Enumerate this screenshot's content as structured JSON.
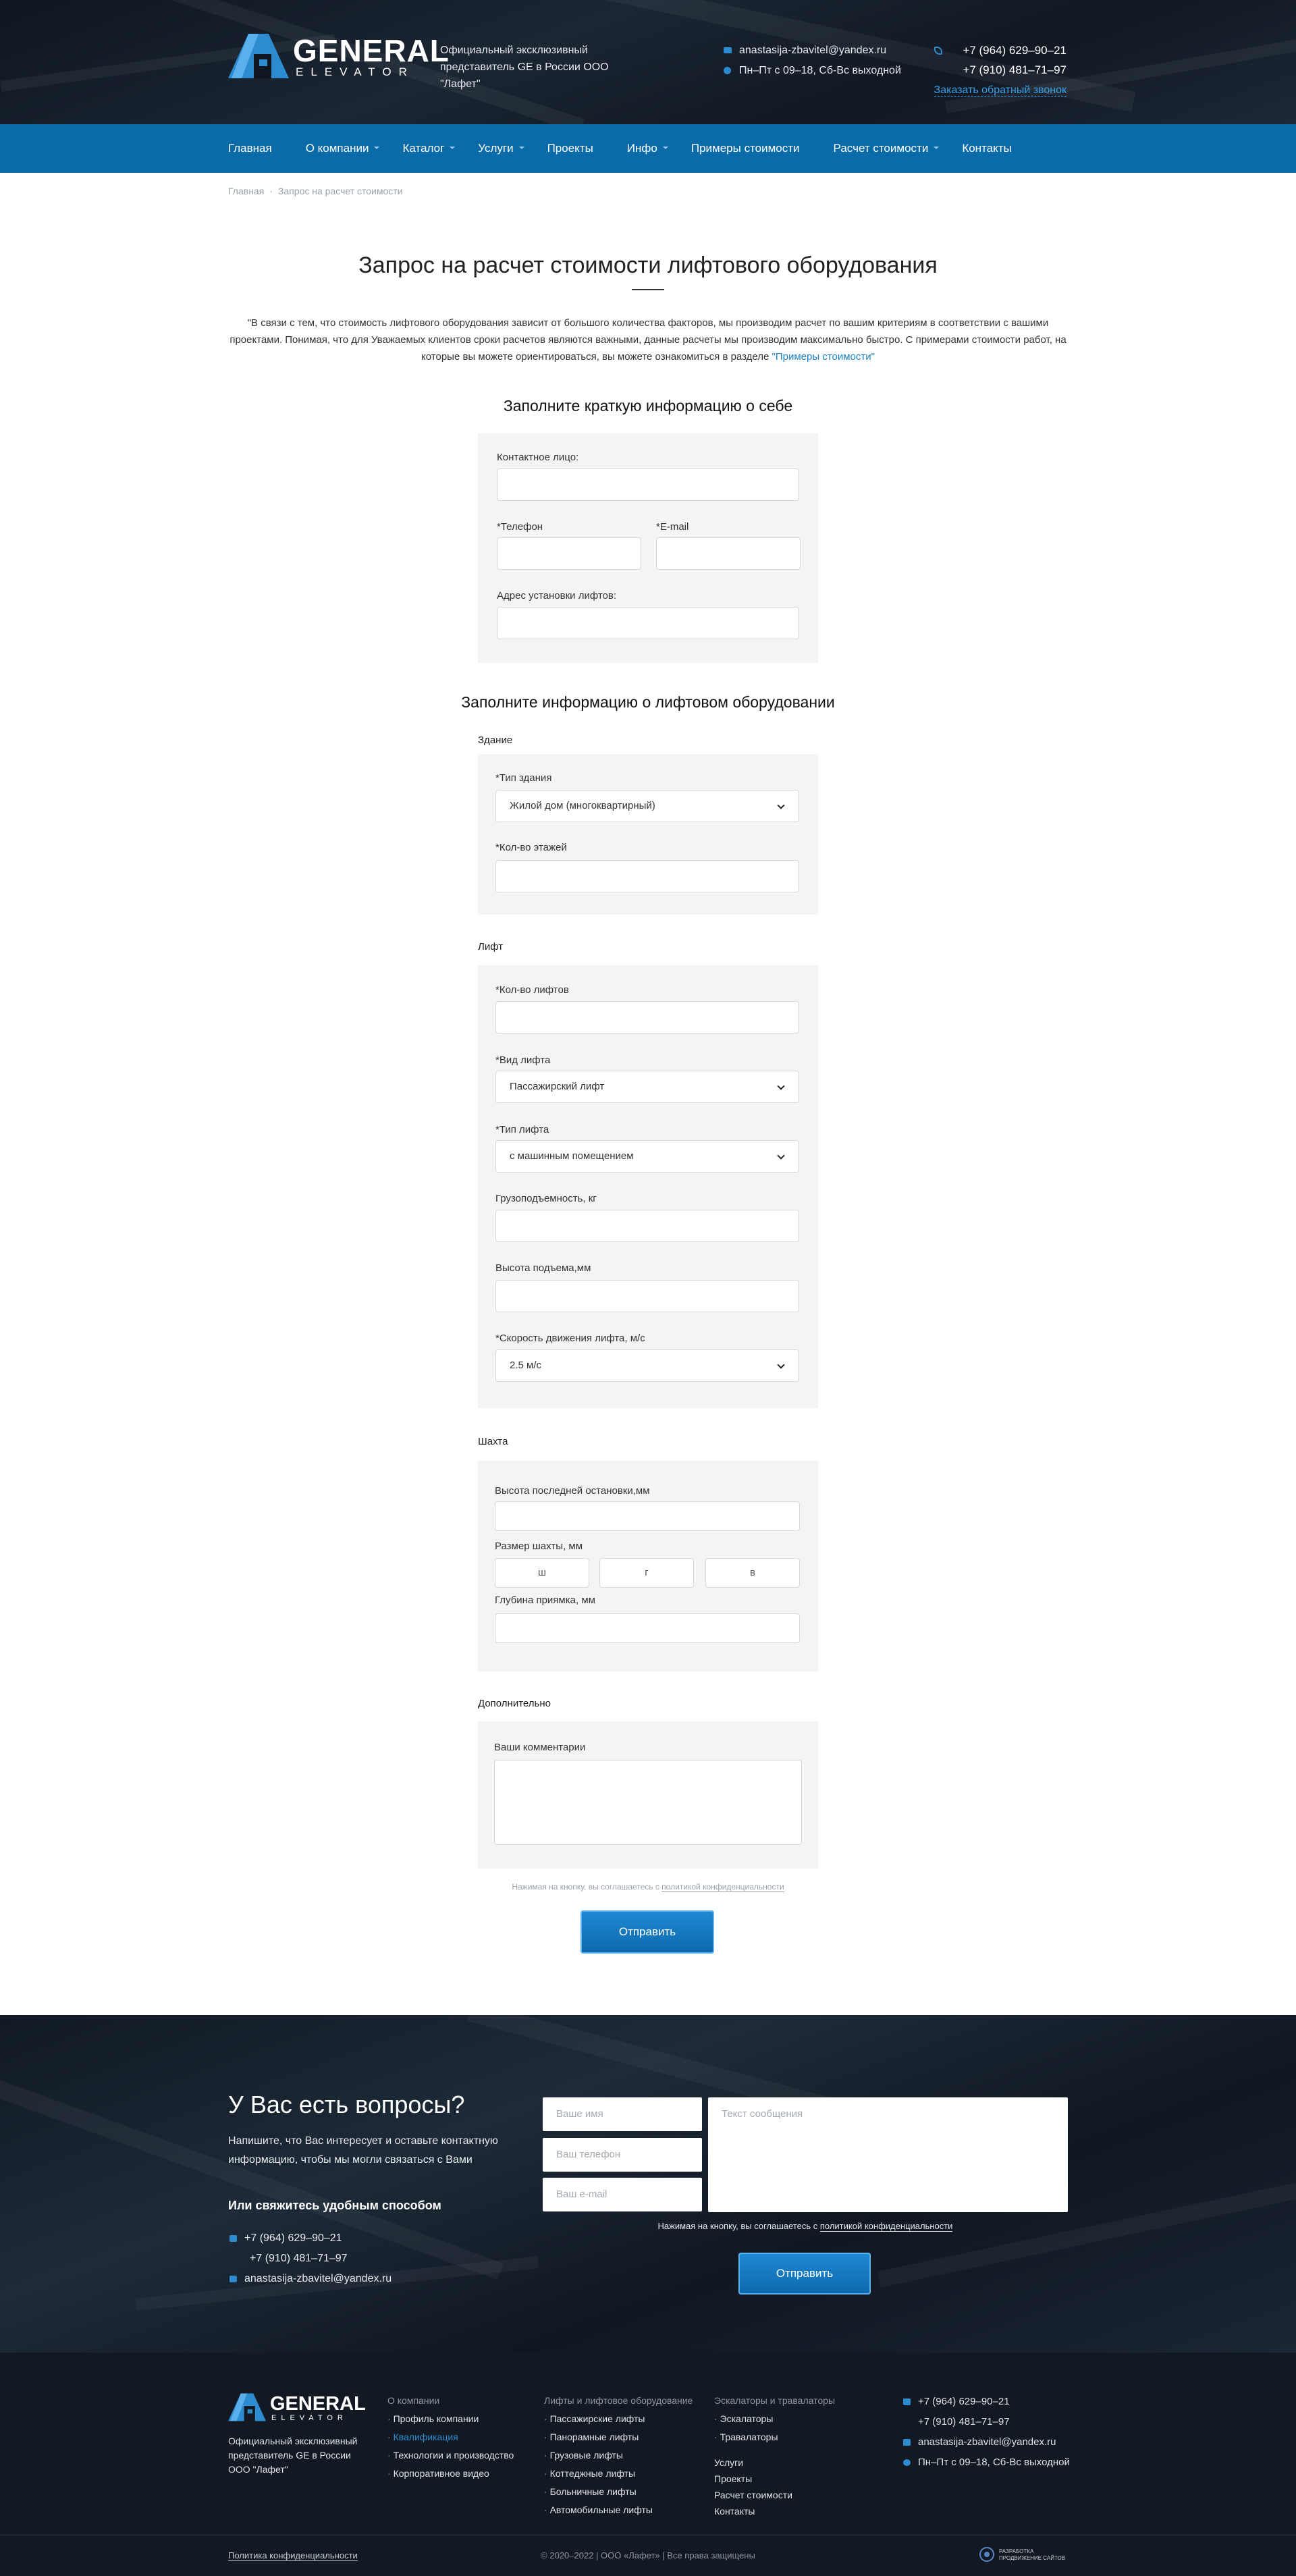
{
  "header": {
    "logo_title": "GENERAL",
    "logo_sub": "ELEVATOR",
    "desc_line1": "Официальный эксклюзивный",
    "desc_line2": "представитель GE в России ООО \"Лафет\"",
    "email": "anastasija-zbavitel@yandex.ru",
    "hours": "Пн–Пт с 09–18, Сб-Вс выходной",
    "phone1": "+7 (964) 629–90–21",
    "phone2": "+7 (910) 481–71–97",
    "callback": "Заказать обратный звонок"
  },
  "nav": {
    "items": [
      "Главная",
      "О компании",
      "Каталог",
      "Услуги",
      "Проекты",
      "Инфо",
      "Примеры стоимости",
      "Расчет стоимости",
      "Контакты"
    ]
  },
  "breadcrumb": {
    "home": "Главная",
    "current": "Запрос на расчет стоимости"
  },
  "page": {
    "title": "Запрос на расчет стоимости лифтового оборудования",
    "intro_1": "\"В связи с тем, что стоимость лифтового оборудования зависит от большого количества факторов, мы производим расчет по вашим критериям в соответствии с вашими проектами. Понимая, что для Уважаемых клиентов сроки расчетов являются важными, данные расчеты мы производим максимально быстро. С примерами стоимости работ, на которые вы можете ориентироваться, вы можете ознакомиться в разделе ",
    "intro_link": "\"Примеры стоимости\""
  },
  "contact": {
    "heading": "Заполните краткую информацию о себе",
    "person_label": "Контактное лицо:",
    "phone_label": "*Телефон",
    "email_label": "*E-mail",
    "address_label": "Адрес установки лифтов:"
  },
  "equipment": {
    "heading": "Заполните информацию о лифтовом оборудовании",
    "building": {
      "title": "Здание",
      "type_label": "*Тип здания",
      "type_value": "Жилой дом (многоквартирный)",
      "floors_label": "*Кол-во этажей"
    },
    "lift": {
      "title": "Лифт",
      "count_label": "*Кол-во лифтов",
      "kind_label": "*Вид лифта",
      "kind_value": "Пассажирский лифт",
      "type_label": "*Тип лифта",
      "type_value": "с машинным помещением",
      "capacity_label": "Грузоподъемность, кг",
      "height_label": "Высота  подъема,мм",
      "speed_label": "*Скорость движения лифта, м/с",
      "speed_value": "2.5 м/с"
    },
    "shaft": {
      "title": "Шахта",
      "last_stop_label": "Высота последней остановки,мм",
      "size_label": "Размер шахты, мм",
      "w_ph": "ш",
      "d_ph": "г",
      "h_ph": "в",
      "pit_label": "Глубина приямка, мм"
    },
    "extra": {
      "title": "Дополнительно",
      "comment_label": "Ваши комментарии"
    }
  },
  "agree": {
    "text": "Нажимая на кнопку, вы соглашаетесь с ",
    "link": "политикой конфиденциальности"
  },
  "submit": "Отправить",
  "questions": {
    "title": "У Вас есть вопросы?",
    "text": "Напишите, что Вас интересует и оставьте контактную информацию, чтобы мы могли связаться с Вами",
    "sub": "Или свяжитесь удобным способом",
    "phone1": "+7 (964) 629–90–21",
    "phone2": "+7 (910) 481–71–97",
    "email": "anastasija-zbavitel@yandex.ru",
    "name_ph": "Ваше имя",
    "phone_ph": "Ваш телефон",
    "email_ph": "Ваш e-mail",
    "msg_ph": "Текст сообщения",
    "agree_text": "Нажимая на кнопку, вы соглашаетесь с ",
    "agree_link": "политикой конфиденциальности",
    "button": "Отправить"
  },
  "footer": {
    "about": "Официальный эксклюзивный представитель GE в России ООО \"Лафет\"",
    "col1_head": "О компании",
    "col1": [
      "Профиль компании",
      "Квалификация",
      "Технологии и производство",
      "Корпоративное видео"
    ],
    "col2_head": "Лифты и лифтовое оборудование",
    "col2": [
      "Пассажирские лифты",
      "Панорамные лифты",
      "Грузовые лифты",
      "Коттеджные лифты",
      "Больничные лифты",
      "Автомобильные лифты"
    ],
    "col3_head": "Эскалаторы и травалаторы",
    "col3": [
      "Эскалаторы",
      "Травалаторы"
    ],
    "col3_links": [
      "Услуги",
      "Проекты",
      "Расчет стоимости",
      "Контакты"
    ],
    "phone1": "+7 (964) 629–90–21",
    "phone2": "+7 (910) 481–71–97",
    "email": "anastasija-zbavitel@yandex.ru",
    "hours": "Пн–Пт с 09–18, Сб-Вс выходной",
    "policy": "Политика конфиденциальности",
    "copyright": "© 2020–2022 | ООО «Лафет» | Все права защищены",
    "dev_1": "РАЗРАБОТКА",
    "dev_2": "ПРОДВИЖЕНИЕ САЙТОВ"
  },
  "colors": {
    "accent": "#0b6aa8",
    "link": "#1a82c9",
    "icon": "#2d8bd0",
    "panel": "#f4f4f4",
    "footer": "#121922"
  }
}
